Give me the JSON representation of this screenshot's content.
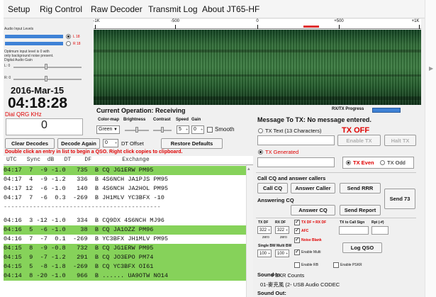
{
  "menu": [
    "Setup",
    "Rig Control",
    "Raw Decoder",
    "Transmit Log",
    "About JT65-HF"
  ],
  "input": {
    "heading": "Audio Input Levels",
    "left": "L 18",
    "right": "R 18",
    "note": [
      "Optimum input level is 0 with",
      "only background noise present."
    ],
    "gain_label": "Digital Audio Gain",
    "gain_l": "L: 0",
    "gain_r": "R: 0"
  },
  "clock": {
    "date": "2016-Mar-15",
    "time": "04:18:28"
  },
  "qrg": {
    "label": "Dial QRG KHz",
    "value": "0"
  },
  "waterfall": {
    "ticks": [
      "-1K",
      "-500",
      "0",
      "+500",
      "+1K"
    ],
    "operation": "Current Operation:  Receiving",
    "rxtx": "RX/TX Progress"
  },
  "controls": {
    "colormap_label": "Color-map",
    "colormap": "Green",
    "brightness": "Brightness",
    "contrast": "Contrast",
    "speed_label": "Speed",
    "speed": "5",
    "gain_label": "Gain",
    "gain": "0",
    "smooth": "Smooth",
    "dt_value": "0",
    "dt_label": "DT Offset"
  },
  "buttons": {
    "clear": "Clear Decodes",
    "decode": "Decode Again",
    "restore": "Restore Defaults"
  },
  "hint": "Double click an entry in list to begin a QSO.  Right click copies to clipboard.",
  "table": {
    "header": "UTC   Sync  dB   DT    DF         Exchange",
    "rows": [
      {
        "t": "04:17  7  -9 -1.0   735  B CQ JG1ERW PM95",
        "g": true
      },
      {
        "t": "04:17  4  -9 -1.2   336  B 4S6NCH JA1PJS PM95",
        "g": false
      },
      {
        "t": "04:17 12  -6 -1.0   140  B 4S6NCH JA2HOL PM95",
        "g": false
      },
      {
        "t": "04:17  7  -6  0.3  -269  B JH1MLV YC3BFX -10",
        "g": false
      },
      {
        "t": "-------------------------------------------",
        "g": false,
        "sep": true
      },
      {
        "t": "04:16  3 -12 -1.0   334  B CQ9DX 4S6NCH MJ96",
        "g": false
      },
      {
        "t": "04:16  5  -6 -1.0    38  B CQ JA1OZZ PM96",
        "g": true
      },
      {
        "t": "04:16  7  -7  0.1  -269  B YC3BFX JH1MLV PM95",
        "g": false
      },
      {
        "t": "04:15  8  -9 -0.8   732  B CQ JG1ERW PM95",
        "g": true
      },
      {
        "t": "04:15  9  -7 -1.2   291  B CQ JO3EPO PM74",
        "g": true
      },
      {
        "t": "04:15  5  -8 -1.8  -269  B CQ YC3BFX OI61",
        "g": true
      },
      {
        "t": "04:14  8 -20 -1.0   966  B ...... UA9OTW NO14",
        "g": true
      }
    ]
  },
  "message": {
    "title": "Message To TX:  No message entered.",
    "tx_text": "TX Text (13 Characters)",
    "tx_off": "TX OFF",
    "enable_tx": "Enable TX",
    "halt_tx": "Halt TX",
    "tx_generated": "TX Generated",
    "tx_even": "TX Even",
    "tx_odd": "TX Odd"
  },
  "callers": {
    "heading": "Call CQ and answer callers",
    "call_cq": "Call CQ",
    "answer_caller": "Answer Caller",
    "send_rrr": "Send RRR",
    "answering": "Answering CQ",
    "send73": "Send 73",
    "answer_cq": "Answer CQ",
    "send_report": "Send Report"
  },
  "df": {
    "tx_df": "TX DF",
    "rx_df": "RX DF",
    "lock": "TX DF = RX DF",
    "tx_val": "322",
    "rx_val": "322",
    "zero": "zero",
    "afc": "AFC",
    "noise": "Noise Blank",
    "single_bw": "Single BW",
    "multi_bw": "Multi BW",
    "single_val": "100",
    "multi_val": "100",
    "enable_multi": "Enable Multi",
    "enable_rb": "Enable RB",
    "enable_psk": "Enable PSKR",
    "tx_call": "TX to Call Sign",
    "rpt": "Rpt (-#)",
    "log": "Log QSO"
  },
  "sound": {
    "in_label": "Sound In:",
    "overlap": "PSKR Counts",
    "in_device": "01-麥克風 (2- USB Audio CODEC",
    "out_label": "Sound Out:"
  }
}
